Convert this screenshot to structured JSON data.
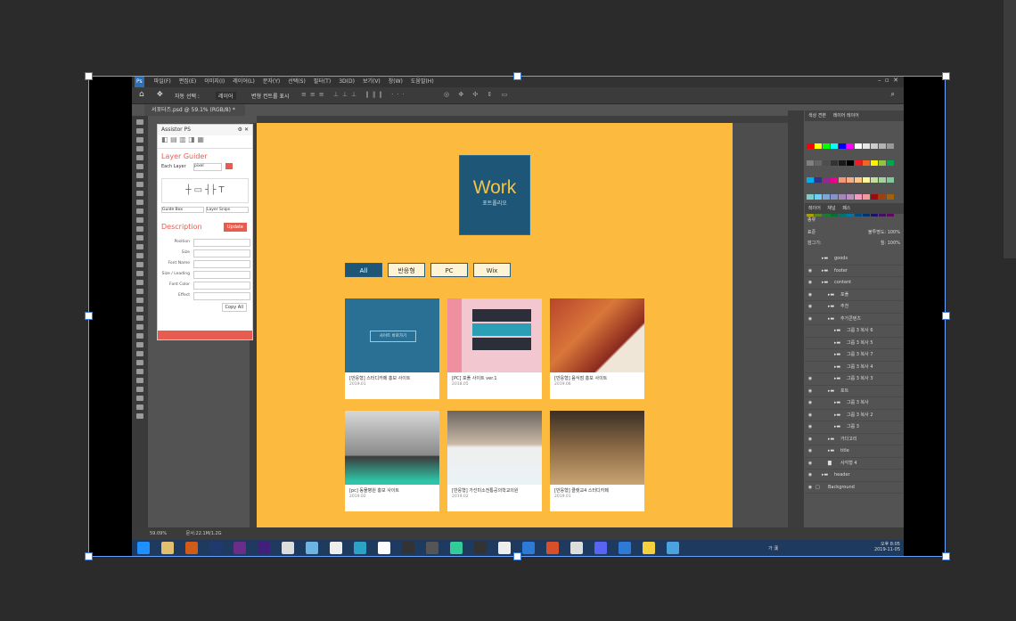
{
  "menu": [
    "파일(F)",
    "편집(E)",
    "이미지(I)",
    "레이어(L)",
    "문자(Y)",
    "선택(S)",
    "필터(T)",
    "3D(D)",
    "보기(V)",
    "창(W)",
    "도움말(H)"
  ],
  "options": {
    "auto_select": "자동 선택 :",
    "target": "레이어",
    "transform": "변형 컨트롤 표시"
  },
  "document_tab": "서포터즈.psd @ 59.1% (RGB/8) *",
  "status": {
    "zoom": "59.09%",
    "doc": "문서:22.1M/1.2G"
  },
  "assistant": {
    "title": "Assistor PS",
    "section": "Layer Guider",
    "each_layer": "Each Layer",
    "pixel_value": "pixel",
    "guide_box": "Guide Box",
    "layer_snips": "Layer Snips",
    "description": "Description",
    "update": "Update",
    "fields": [
      "Position",
      "Size",
      "Font Name",
      "Size / Leading",
      "Font Color",
      "Effect"
    ],
    "copy_all": "Copy All"
  },
  "site": {
    "logo_title": "Work",
    "logo_sub": "포트폴리오",
    "filters": [
      "All",
      "반응형",
      "PC",
      "Wix"
    ],
    "cards": [
      {
        "title": "[반응형] 스터디카페 홍보 사이트",
        "date": "2019.01"
      },
      {
        "title": "[PC] 포폴 사이트 ver.1",
        "date": "2018.05"
      },
      {
        "title": "[반응형] 음식점 홍보 사이트",
        "date": "2019.06"
      },
      {
        "title": "[pc] 동물병원 홍보 사이트",
        "date": "2019.02"
      },
      {
        "title": "[반응형] 가선미소전통공의학교의원",
        "date": "2019.02"
      },
      {
        "title": "[반응형] 클랫교4 스터디카페",
        "date": "2019.01"
      }
    ],
    "thumb_button": "사이트 바로가기"
  },
  "panels": {
    "tabs_top": [
      "색상 견본",
      "레이어 레이어"
    ],
    "tabs_layers": [
      "레이어",
      "채널",
      "패스"
    ],
    "filter": "종류",
    "blend": "표준",
    "opacity": "불투명도: 100%",
    "fill": "칠: 100%",
    "lock": "잠그기:"
  },
  "layers": [
    {
      "name": "goods",
      "indent": 1,
      "type": "folder",
      "visible": false
    },
    {
      "name": "footer",
      "indent": 1,
      "type": "folder",
      "visible": true
    },
    {
      "name": "content",
      "indent": 1,
      "type": "folder",
      "visible": true
    },
    {
      "name": "포폴",
      "indent": 2,
      "type": "folder",
      "visible": true
    },
    {
      "name": "추천",
      "indent": 2,
      "type": "folder",
      "visible": true
    },
    {
      "name": "추가콘텐츠",
      "indent": 2,
      "type": "folder",
      "visible": true
    },
    {
      "name": "그룹 3 복사 6",
      "indent": 3,
      "type": "folder",
      "visible": false
    },
    {
      "name": "그룹 3 복사 5",
      "indent": 3,
      "type": "folder",
      "visible": false
    },
    {
      "name": "그룹 3 복사 7",
      "indent": 3,
      "type": "folder",
      "visible": false
    },
    {
      "name": "그룹 3 복사 4",
      "indent": 3,
      "type": "folder",
      "visible": false
    },
    {
      "name": "그룹 3 복사 3",
      "indent": 3,
      "type": "folder",
      "visible": true
    },
    {
      "name": "포트",
      "indent": 2,
      "type": "folder",
      "visible": true
    },
    {
      "name": "그룹 3 복사",
      "indent": 3,
      "type": "folder",
      "visible": true
    },
    {
      "name": "그룹 3 복사 2",
      "indent": 3,
      "type": "folder",
      "visible": true
    },
    {
      "name": "그룹 3",
      "indent": 3,
      "type": "folder",
      "visible": true
    },
    {
      "name": "가다고리",
      "indent": 2,
      "type": "folder",
      "visible": true
    },
    {
      "name": "title",
      "indent": 2,
      "type": "folder",
      "visible": true
    },
    {
      "name": "사각형 4",
      "indent": 2,
      "type": "shape",
      "visible": true
    },
    {
      "name": "header",
      "indent": 1,
      "type": "folder",
      "visible": true
    },
    {
      "name": "Background",
      "indent": 0,
      "type": "bg",
      "visible": true
    }
  ],
  "tray": {
    "ime": "가 漢",
    "time": "오후 8:05",
    "date": "2019-11-05"
  },
  "colors": {
    "canvas": "#FCBB3E",
    "navy": "#1E5677",
    "ps_bg": "#535353",
    "accent": "#E65C4F"
  }
}
